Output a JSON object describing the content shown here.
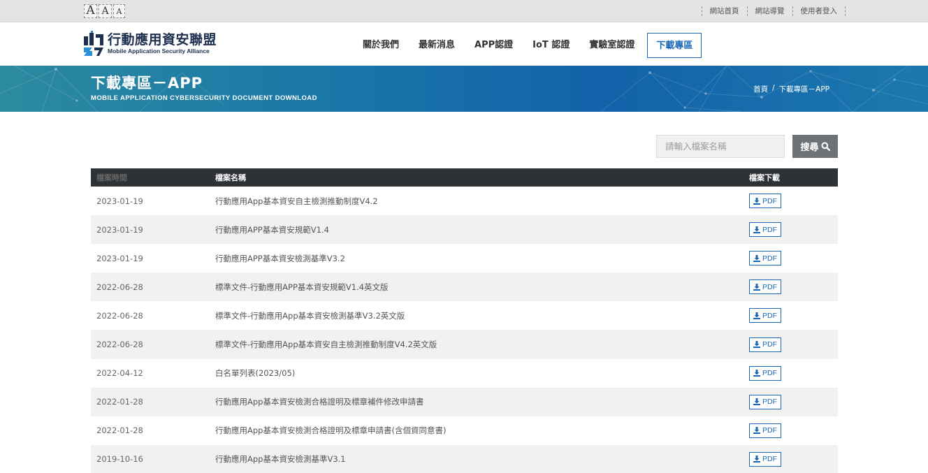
{
  "font_sizes": [
    "A",
    "A",
    "A"
  ],
  "top_links": [
    "網站首頁",
    "網站導覽",
    "使用者登入"
  ],
  "logo": {
    "zh": "行動應用資安聯盟",
    "en": "Mobile Application Security Alliance"
  },
  "nav": [
    "關於我們",
    "最新消息",
    "APP認證",
    "IoT 認證",
    "實驗室認證",
    "下載專區"
  ],
  "banner": {
    "title": "下載專區－APP",
    "subtitle": "MOBILE APPLICATION CYBERSECURITY DOCUMENT DOWNLOAD",
    "breadcrumb": [
      "首頁",
      "/",
      "下載專區－APP"
    ]
  },
  "search": {
    "placeholder": "請輸入檔案名稱",
    "button": "搜尋"
  },
  "table": {
    "headers": [
      "檔案時間",
      "檔案名稱",
      "檔案下載"
    ],
    "rows": [
      {
        "date": "2023-01-19",
        "name": "行動應用App基本資安自主檢測推動制度V4.2",
        "download": "PDF"
      },
      {
        "date": "2023-01-19",
        "name": "行動應用APP基本資安規範V1.4",
        "download": "PDF"
      },
      {
        "date": "2023-01-19",
        "name": "行動應用APP基本資安檢測基準V3.2",
        "download": "PDF"
      },
      {
        "date": "2022-06-28",
        "name": "標準文件-行動應用APP基本資安規範V1.4英文版",
        "download": "PDF"
      },
      {
        "date": "2022-06-28",
        "name": "標準文件-行動應用App基本資安檢測基準V3.2英文版",
        "download": "PDF"
      },
      {
        "date": "2022-06-28",
        "name": "標準文件-行動應用App基本資安自主檢測推動制度V4.2英文版",
        "download": "PDF"
      },
      {
        "date": "2022-04-12",
        "name": "白名單列表(2023/05)",
        "download": "PDF"
      },
      {
        "date": "2022-01-28",
        "name": "行動應用App基本資安檢測合格證明及標章補件修改申請書",
        "download": "PDF"
      },
      {
        "date": "2022-01-28",
        "name": "行動應用App基本資安檢測合格證明及標章申請書(含個資同意書)",
        "download": "PDF"
      },
      {
        "date": "2019-10-16",
        "name": "行動應用App基本資安檢測基準V3.1",
        "download": "PDF"
      }
    ]
  },
  "colors": {
    "accent": "#1a67b5",
    "header_dark": "#2e3237",
    "search_button": "#6e7175"
  }
}
